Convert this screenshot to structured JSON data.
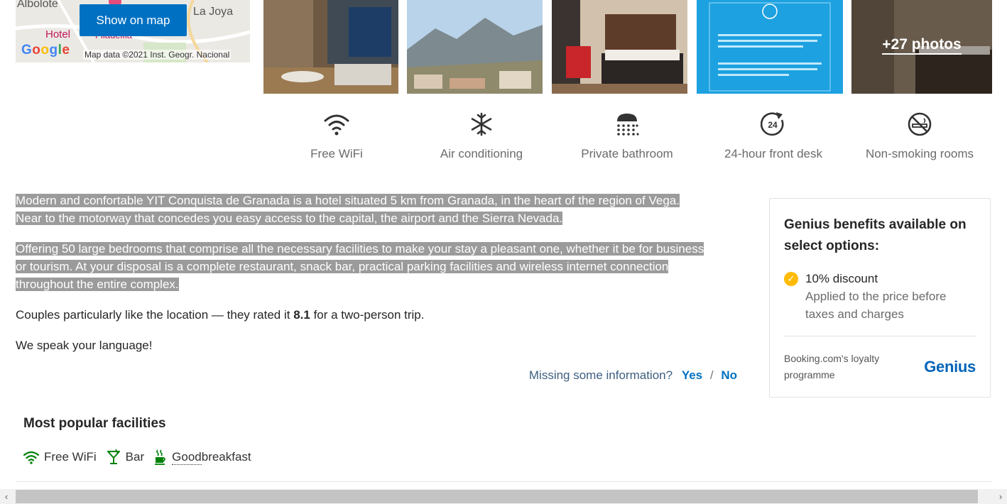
{
  "map": {
    "labels": [
      "Albolote",
      "La Joya"
    ],
    "hotel_label": "Hotel",
    "hotel_label_2": "Filadelfia",
    "google": "Google",
    "credit": "Map data ©2021 Inst. Geogr. Nacional",
    "show_on_map": "Show on map"
  },
  "photos": {
    "more_label": "+27 photos"
  },
  "top_facilities": [
    {
      "icon": "wifi-icon",
      "label": "Free WiFi"
    },
    {
      "icon": "snowflake-icon",
      "label": "Air conditioning"
    },
    {
      "icon": "shower-icon",
      "label": "Private bathroom"
    },
    {
      "icon": "24h-icon",
      "label": "24-hour front desk"
    },
    {
      "icon": "no-smoking-icon",
      "label": "Non-smoking rooms"
    }
  ],
  "description": {
    "p1_line1": "Modern and confortable YIT Conquista de Granada is a hotel situated 5 km from Granada, in the heart of the region of Vega.",
    "p1_line2": "Near to the motorway that concedes you easy access to the capital, the airport and the Sierra Nevada.",
    "p2_line1": "Offering 50 large bedrooms that comprise all the necessary facilities to make your stay a pleasant one, whether it be for business",
    "p2_line2": "or tourism. At your disposal is a complete restaurant, snack bar, practical parking facilities and wireless internet connection",
    "p2_line3": "throughout the entire complex.",
    "p3_before": "Couples particularly like the location — they rated it ",
    "p3_rating": "8.1",
    "p3_after": " for a two-person trip.",
    "p4": "We speak your language!"
  },
  "missing_info": {
    "question": "Missing some information?",
    "yes": "Yes",
    "sep": "/",
    "no": "No"
  },
  "genius": {
    "title": "Genius benefits available on select options:",
    "item_title": "10% discount",
    "item_desc": "Applied to the price before taxes and charges",
    "loyalty": "Booking.com's loyalty programme",
    "logo": "Genius",
    "check_color": "#febb02"
  },
  "popular": {
    "title": "Most popular facilities",
    "items": [
      {
        "icon": "wifi-icon",
        "label": "Free WiFi"
      },
      {
        "icon": "cocktail-icon",
        "label": "Bar"
      },
      {
        "icon": "coffee-icon",
        "label_part1": "Good",
        "label_part2": " breakfast"
      }
    ],
    "icon_color": "#008009"
  },
  "scrollbar": {
    "left_arrow": "‹",
    "right_arrow": "›"
  }
}
